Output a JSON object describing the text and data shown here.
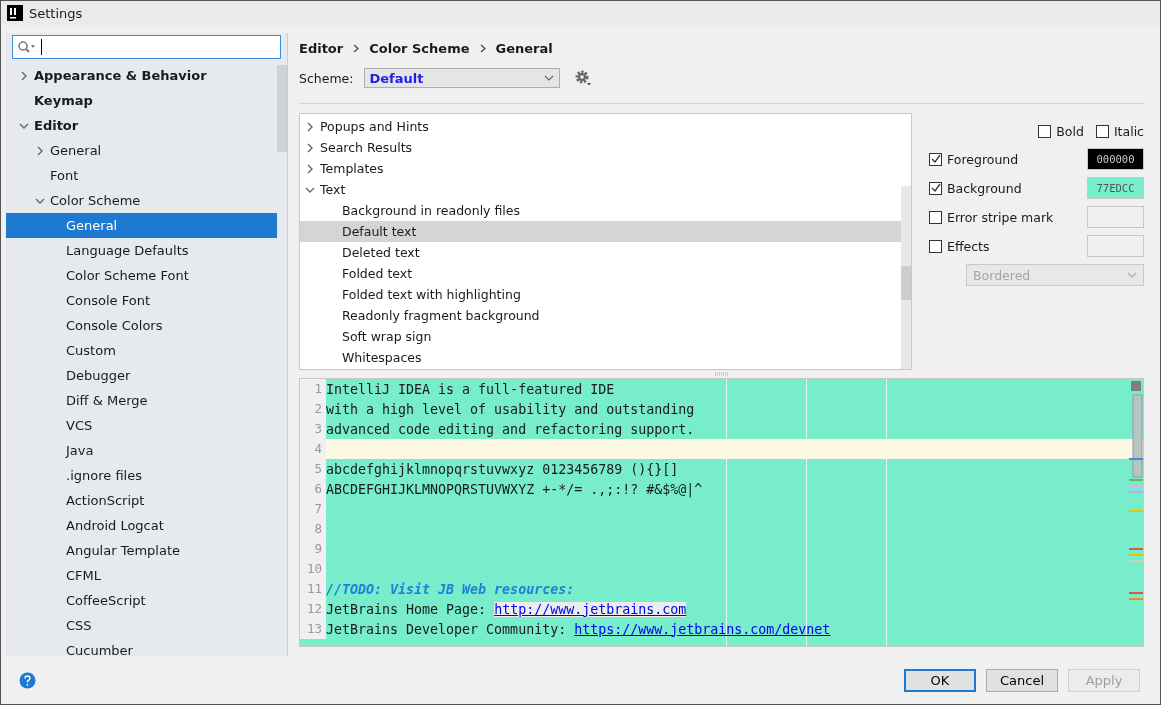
{
  "window": {
    "title": "Settings"
  },
  "sidebar": {
    "items": [
      {
        "label": "Appearance & Behavior",
        "expanded": false,
        "selected": false
      },
      {
        "label": "Keymap",
        "selected": false
      },
      {
        "label": "Editor",
        "expanded": true,
        "selected": false,
        "children": [
          {
            "label": "General",
            "expanded": false,
            "selected": false
          },
          {
            "label": "Font",
            "selected": false
          },
          {
            "label": "Color Scheme",
            "expanded": true,
            "selected": false,
            "children": [
              {
                "label": "General",
                "selected": true
              },
              {
                "label": "Language Defaults",
                "selected": false
              },
              {
                "label": "Color Scheme Font",
                "selected": false
              },
              {
                "label": "Console Font",
                "selected": false
              },
              {
                "label": "Console Colors",
                "selected": false
              },
              {
                "label": "Custom",
                "selected": false
              },
              {
                "label": "Debugger",
                "selected": false
              },
              {
                "label": "Diff & Merge",
                "selected": false
              },
              {
                "label": "VCS",
                "selected": false
              },
              {
                "label": "Java",
                "selected": false
              },
              {
                "label": ".ignore files",
                "selected": false
              },
              {
                "label": "ActionScript",
                "selected": false
              },
              {
                "label": "Android Logcat",
                "selected": false
              },
              {
                "label": "Angular Template",
                "selected": false
              },
              {
                "label": "CFML",
                "selected": false
              },
              {
                "label": "CoffeeScript",
                "selected": false
              },
              {
                "label": "CSS",
                "selected": false
              },
              {
                "label": "Cucumber",
                "selected": false
              }
            ]
          }
        ]
      }
    ]
  },
  "breadcrumb": [
    "Editor",
    "Color Scheme",
    "General"
  ],
  "scheme": {
    "label": "Scheme:",
    "value": "Default"
  },
  "attributes": [
    {
      "label": "Popups and Hints",
      "expanded": false,
      "selected": false
    },
    {
      "label": "Search Results",
      "expanded": false,
      "selected": false
    },
    {
      "label": "Templates",
      "expanded": false,
      "selected": false
    },
    {
      "label": "Text",
      "expanded": true,
      "selected": false,
      "children": [
        {
          "label": "Background in readonly files",
          "selected": false
        },
        {
          "label": "Default text",
          "selected": true
        },
        {
          "label": "Deleted text",
          "selected": false
        },
        {
          "label": "Folded text",
          "selected": false
        },
        {
          "label": "Folded text with highlighting",
          "selected": false
        },
        {
          "label": "Readonly fragment background",
          "selected": false
        },
        {
          "label": "Soft wrap sign",
          "selected": false
        },
        {
          "label": "Whitespaces",
          "selected": false
        }
      ]
    }
  ],
  "style_options": [
    {
      "label": "Bold",
      "checked": false
    },
    {
      "label": "Italic",
      "checked": false
    }
  ],
  "color_options": [
    {
      "label": "Foreground",
      "checked": true,
      "value": "000000",
      "color": "#000000"
    },
    {
      "label": "Background",
      "checked": true,
      "value": "77EDCC",
      "color": "#77edcc"
    },
    {
      "label": "Error stripe mark",
      "checked": false
    },
    {
      "label": "Effects",
      "checked": false
    }
  ],
  "effect_type": {
    "value": "Bordered",
    "disabled": true
  },
  "preview": {
    "lines": [
      {
        "number": "1",
        "current": false,
        "segments": [
          {
            "kind": "plain",
            "text": "IntelliJ IDEA is a full-featured IDE"
          }
        ]
      },
      {
        "number": "2",
        "current": false,
        "segments": [
          {
            "kind": "plain",
            "text": "with a high level of usability and outstanding"
          }
        ]
      },
      {
        "number": "3",
        "current": false,
        "segments": [
          {
            "kind": "plain",
            "text": "advanced code editing and refactoring support."
          }
        ]
      },
      {
        "number": "4",
        "current": true
      },
      {
        "number": "5",
        "current": false,
        "segments": [
          {
            "kind": "plain",
            "text": "abcdefghijklmnopqrstuvwxyz 0123456789 (){}[]"
          }
        ]
      },
      {
        "number": "6",
        "current": false,
        "segments": [
          {
            "kind": "plain",
            "text": "ABCDEFGHIJKLMNOPQRSTUVWXYZ +-*/= .,;:!? #&$%@|^"
          }
        ]
      },
      {
        "number": "7",
        "current": false
      },
      {
        "number": "8",
        "current": false
      },
      {
        "number": "9",
        "current": false
      },
      {
        "number": "10",
        "current": false
      },
      {
        "number": "11",
        "current": false,
        "segments": [
          {
            "kind": "todo",
            "text": "//TODO: Visit JB Web resources:"
          }
        ]
      },
      {
        "number": "12",
        "current": false,
        "segments": [
          {
            "kind": "plain",
            "text": "JetBrains Home Page: "
          },
          {
            "kind": "hovered-link",
            "text": "http://www.jetbrains.com"
          }
        ]
      },
      {
        "number": "13",
        "current": false,
        "segments": [
          {
            "kind": "plain",
            "text": "JetBrains Developer Community: "
          },
          {
            "kind": "link",
            "text": "https://www.jetbrains.com/devnet"
          }
        ]
      }
    ]
  },
  "buttons": [
    {
      "label": "OK",
      "kind": "default",
      "disabled": false
    },
    {
      "label": "Cancel",
      "kind": "normal",
      "disabled": false
    },
    {
      "label": "Apply",
      "kind": "normal",
      "disabled": true
    }
  ]
}
